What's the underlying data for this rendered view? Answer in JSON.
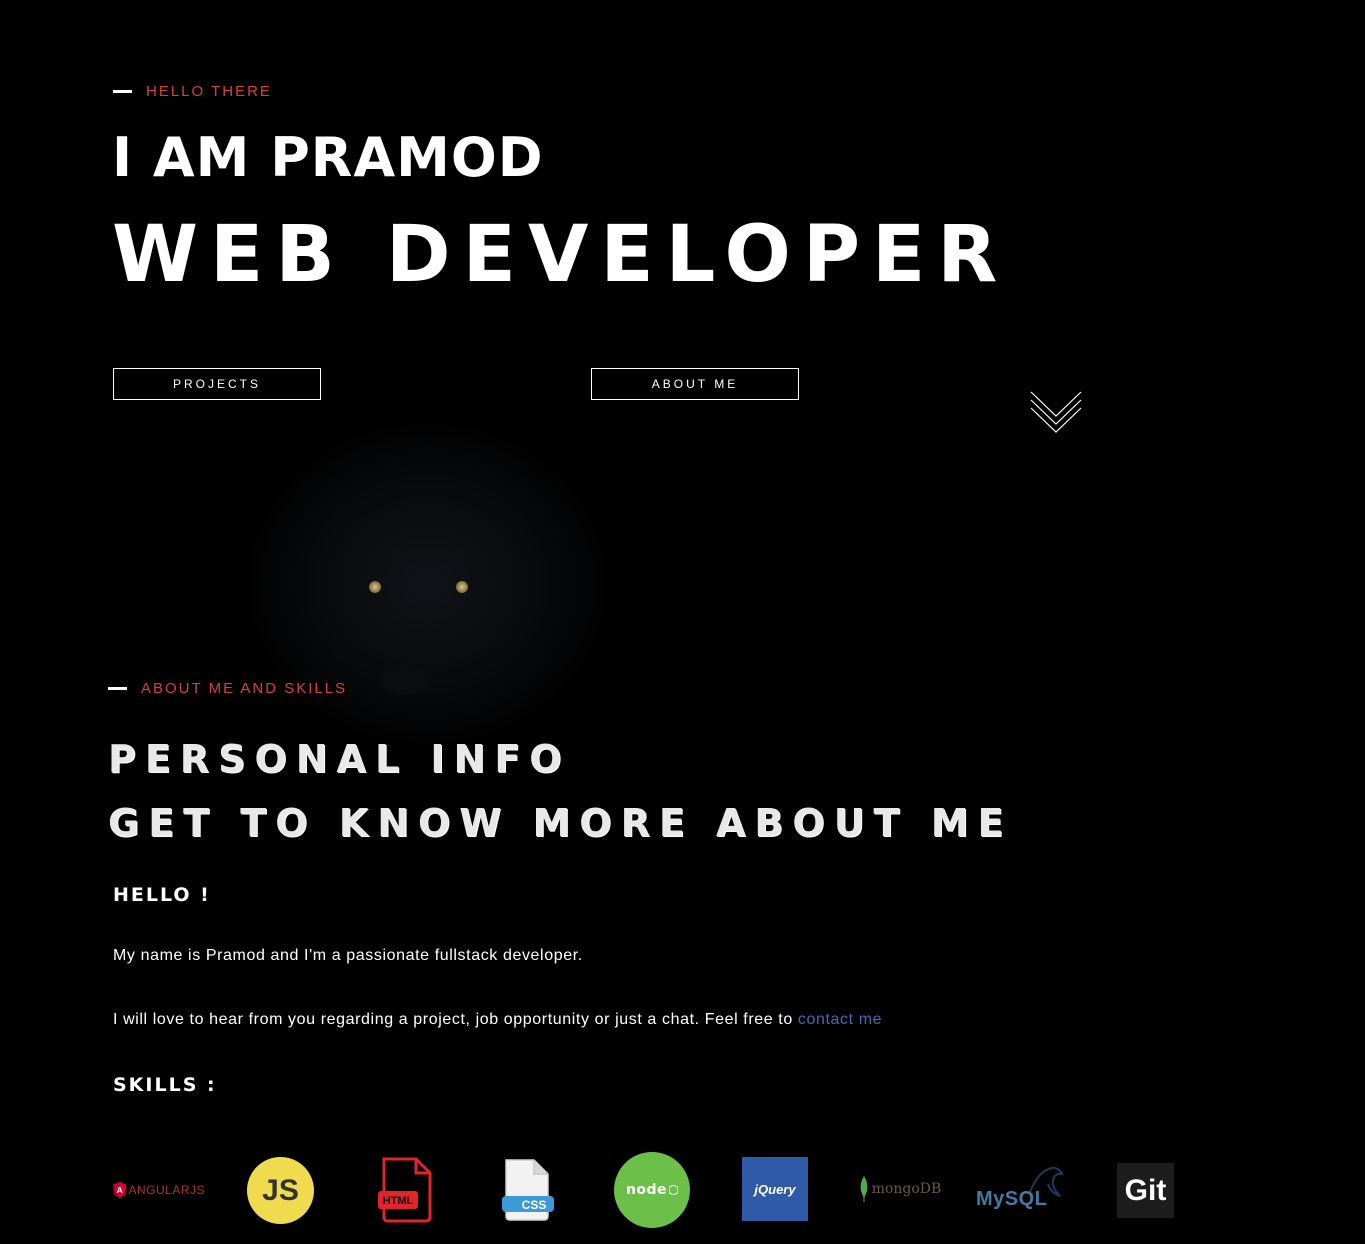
{
  "hero": {
    "eyebrow": "HELLO THERE",
    "name": "I AM PRAMOD",
    "role": "WEB DEVELOPER",
    "buttons": {
      "projects": "PROJECTS",
      "about": "ABOUT ME"
    }
  },
  "about": {
    "eyebrow": "ABOUT ME AND SKILLS",
    "title_line1": "PERSONAL INFO",
    "title_line2": "GET TO KNOW MORE ABOUT ME",
    "greeting": "HELLO !",
    "intro": "My name is Pramod and I'm a passionate fullstack developer.",
    "contact_text": "I will love to hear from you regarding a project, job opportunity or just a chat. Feel free to ",
    "contact_link": "contact me",
    "skills_heading": "SKILLS :"
  },
  "skills": {
    "angular": "ANGULARJS",
    "js": "JS",
    "html": "HTML",
    "css": "CSS",
    "node": "node",
    "jquery": "jQuery",
    "mongo": "mongoDB",
    "mysql": "MySQL",
    "git": "Git"
  },
  "colors": {
    "accent": "#d9423a",
    "link": "#4a67b8",
    "background": "#000000"
  }
}
